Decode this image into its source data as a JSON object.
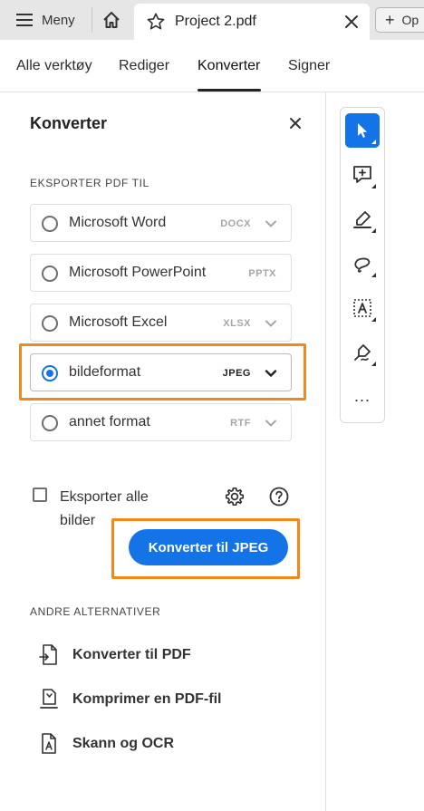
{
  "tabbar": {
    "menu_label": "Meny",
    "doc_tab_title": "Project 2.pdf",
    "open_label": "Op"
  },
  "nav": {
    "tabs": [
      {
        "label": "Alle verktøy"
      },
      {
        "label": "Rediger"
      },
      {
        "label": "Konverter"
      },
      {
        "label": "Signer"
      }
    ],
    "active_index": 2
  },
  "panel": {
    "title": "Konverter",
    "export_section_label": "EKSPORTER PDF TIL",
    "options": [
      {
        "label": "Microsoft Word",
        "format": "DOCX",
        "selected": false
      },
      {
        "label": "Microsoft PowerPoint",
        "format": "PPTX",
        "selected": false
      },
      {
        "label": "Microsoft Excel",
        "format": "XLSX",
        "selected": false
      },
      {
        "label": "bildeformat",
        "format": "JPEG",
        "selected": true
      },
      {
        "label": "annet format",
        "format": "RTF",
        "selected": false
      }
    ],
    "export_all_images_label": "Eksporter alle bilder",
    "export_all_images_checked": false,
    "convert_button_label": "Konverter til JPEG",
    "other_section_label": "ANDRE ALTERNATIVER",
    "other_options": [
      {
        "label": "Konverter til PDF",
        "icon": "convert-to-pdf-icon"
      },
      {
        "label": "Komprimer en PDF-fil",
        "icon": "compress-pdf-icon"
      },
      {
        "label": "Skann og OCR",
        "icon": "scan-ocr-icon"
      }
    ]
  },
  "toolbar": {
    "tools": [
      {
        "icon": "select-cursor-icon",
        "active": true
      },
      {
        "icon": "add-comment-icon",
        "active": false
      },
      {
        "icon": "highlight-pen-icon",
        "active": false
      },
      {
        "icon": "draw-freehand-icon",
        "active": false
      },
      {
        "icon": "text-recognition-icon",
        "active": false
      },
      {
        "icon": "sign-pen-icon",
        "active": false
      }
    ],
    "more_label": "..."
  },
  "colors": {
    "accent_blue": "#1473e6",
    "highlight_orange": "#f0891d",
    "tabbar_bg": "#e6e6e6"
  }
}
